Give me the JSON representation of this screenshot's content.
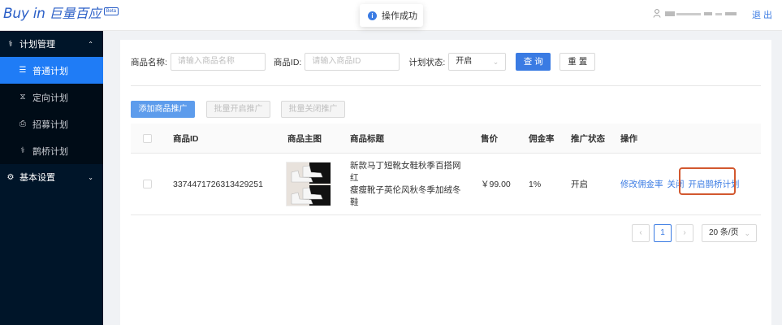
{
  "header": {
    "logo_en": "Buy in",
    "logo_cn": "巨量百应",
    "beta": "Beta",
    "user_name": "&#8203;",
    "logout": "退 出"
  },
  "toast": {
    "icon": "i",
    "text": "操作成功"
  },
  "sidebar": {
    "groups": [
      {
        "label": "计划管理",
        "icon": "plan-icon",
        "expanded": true,
        "items": [
          {
            "label": "普通计划",
            "icon": "list-icon",
            "active": true
          },
          {
            "label": "定向计划",
            "icon": "hourglass-icon"
          },
          {
            "label": "招募计划",
            "icon": "recruit-icon"
          },
          {
            "label": "鹊桥计划",
            "icon": "bridge-icon"
          }
        ]
      },
      {
        "label": "基本设置",
        "icon": "gear-icon",
        "expanded": false
      }
    ]
  },
  "filters": {
    "name_label": "商品名称:",
    "name_placeholder": "请输入商品名称",
    "id_label": "商品ID:",
    "id_placeholder": "请输入商品ID",
    "status_label": "计划状态:",
    "status_value": "开启",
    "search": "查 询",
    "reset": "重 置"
  },
  "actions": {
    "add": "添加商品推广",
    "batch_open": "批量开启推广",
    "batch_close": "批量关闭推广"
  },
  "table": {
    "columns": [
      "商品ID",
      "商品主图",
      "商品标题",
      "售价",
      "佣金率",
      "推广状态",
      "操作"
    ],
    "rows": [
      {
        "id": "3374471726313429251",
        "title_line1": "新款马丁短靴女鞋秋季百搭网红",
        "title_line2": "瘦瘦靴子英伦风秋冬季加绒冬鞋",
        "price": "￥99.00",
        "commission": "1%",
        "status": "开启",
        "op_edit": "修改佣金率",
        "op_close": "关闭",
        "op_bridge": "开启鹊桥计划"
      }
    ]
  },
  "pagination": {
    "current_page": "1",
    "page_size": "20 条/页"
  }
}
